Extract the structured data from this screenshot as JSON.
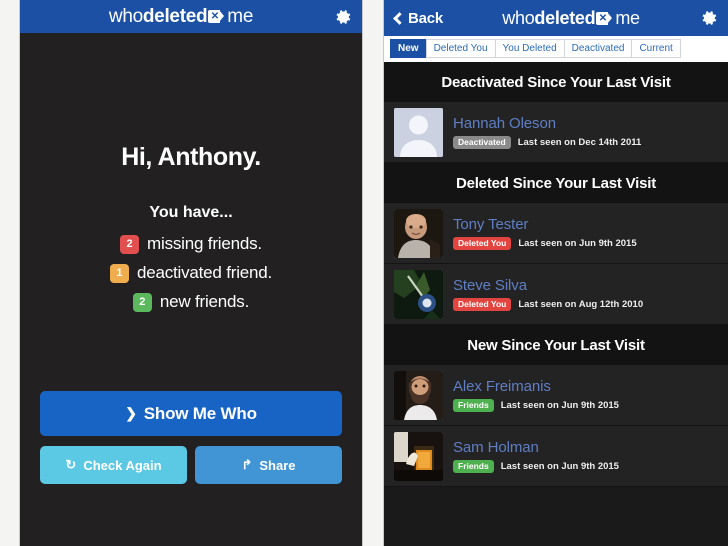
{
  "left": {
    "navbar": {
      "title_prefix": "who ",
      "title_bold": "deleted",
      "title_suffix": " me",
      "logo_glyph": "✕",
      "gear_label": "settings-gear"
    },
    "greeting": "Hi, Anthony.",
    "subhead": "You have...",
    "stats": [
      {
        "count": "2",
        "label": "missing friends.",
        "color": "#e1504f",
        "tone": "red"
      },
      {
        "count": "1",
        "label": "deactivated friend.",
        "color": "#f0ad4e",
        "tone": "amber"
      },
      {
        "count": "2",
        "label": "new friends.",
        "color": "#5cb85c",
        "tone": "green"
      }
    ],
    "buttons": {
      "primary": {
        "label": "Show Me Who",
        "icon": "❯",
        "color": "#1864c4"
      },
      "check_again": {
        "label": "Check Again",
        "icon": "↻",
        "color": "#5bc8e4"
      },
      "share": {
        "label": "Share",
        "icon": "↱",
        "color": "#4195d5"
      }
    }
  },
  "right": {
    "navbar": {
      "back_label": "Back",
      "title_prefix": "who ",
      "title_bold": "deleted",
      "title_suffix": " me",
      "logo_glyph": "✕",
      "gear_label": "settings-gear"
    },
    "tabs": [
      {
        "label": "New",
        "active": true
      },
      {
        "label": "Deleted You",
        "active": false
      },
      {
        "label": "You Deleted",
        "active": false
      },
      {
        "label": "Deactivated",
        "active": false
      },
      {
        "label": "Current",
        "active": false
      }
    ],
    "sections": [
      {
        "header": "Deactivated Since Your Last Visit",
        "people": [
          {
            "name": "Hannah Oleson",
            "pill": "Deactivated",
            "pill_tone": "gray",
            "pill_color": "#8a8a8a",
            "last_seen": "Last seen on Dec 14th 2011",
            "avatar": "placeholder-silhouette"
          }
        ]
      },
      {
        "header": "Deleted Since Your Last Visit",
        "people": [
          {
            "name": "Tony Tester",
            "pill": "Deleted You",
            "pill_tone": "red",
            "pill_color": "#e2453f",
            "last_seen": "Last seen on Jun 9th 2015",
            "avatar": "photo-man-bald"
          },
          {
            "name": "Steve Silva",
            "pill": "Deleted You",
            "pill_tone": "red",
            "pill_color": "#e2453f",
            "last_seen": "Last seen on Aug 12th 2010",
            "avatar": "photo-dark-outdoor"
          }
        ]
      },
      {
        "header": "New Since Your Last Visit",
        "people": [
          {
            "name": "Alex Freimanis",
            "pill": "Friends",
            "pill_tone": "green",
            "pill_color": "#4fb04f",
            "last_seen": "Last seen on Jun 9th 2015",
            "avatar": "photo-bearded-man"
          },
          {
            "name": "Sam Holman",
            "pill": "Friends",
            "pill_tone": "green",
            "pill_color": "#4fb04f",
            "last_seen": "Last seen on Jun 9th 2015",
            "avatar": "photo-drink-pour"
          }
        ]
      }
    ]
  },
  "theme": {
    "nav_blue": "#1b50a4",
    "panel_dark": "#222020",
    "list_row": "#232323",
    "list_header": "#131313",
    "name_blue": "#5f7ec4"
  }
}
